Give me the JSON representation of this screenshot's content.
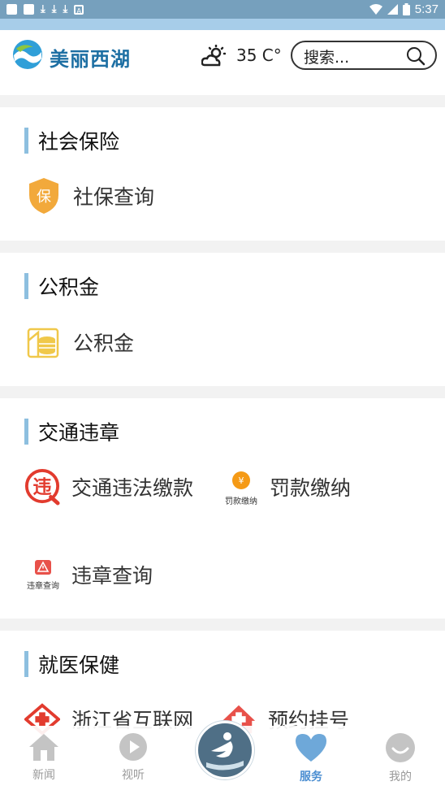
{
  "status_bar": {
    "time": "5:37"
  },
  "header": {
    "brand": "美丽西湖",
    "temperature": "35 C°",
    "search_placeholder": "搜索..."
  },
  "sections": [
    {
      "title": "社会保险",
      "items": [
        {
          "label": "社保查询",
          "icon": "shield-bao-icon"
        }
      ]
    },
    {
      "title": "公积金",
      "items": [
        {
          "label": "公积金",
          "icon": "house-coins-icon"
        }
      ]
    },
    {
      "title": "交通违章",
      "items": [
        {
          "label": "交通违法缴款",
          "icon": "wei-badge-icon"
        },
        {
          "label": "罚款缴纳",
          "icon": "yen-coin-icon",
          "caption": "罚款缴纳"
        },
        {
          "label": "违章查询",
          "icon": "warning-icon",
          "caption": "违章查询"
        }
      ]
    },
    {
      "title": "就医保健",
      "items": [
        {
          "label": "浙江省互联网",
          "icon": "medical-cross-icon"
        },
        {
          "label": "预约挂号",
          "icon": "hospital-icon"
        }
      ]
    }
  ],
  "bottom_nav": {
    "items": [
      {
        "label": "新闻",
        "icon": "home-icon",
        "active": false
      },
      {
        "label": "视听",
        "icon": "play-icon",
        "active": false
      },
      {
        "label": "",
        "icon": "center-logo-icon",
        "active": false
      },
      {
        "label": "服务",
        "icon": "heart-icon",
        "active": true
      },
      {
        "label": "我的",
        "icon": "smiley-icon",
        "active": false
      }
    ]
  },
  "colors": {
    "status_bar": "#76a0bd",
    "accent_bar": "#8dbfdf",
    "active_nav": "#4b8ed1",
    "brand": "#1d6fa3"
  }
}
